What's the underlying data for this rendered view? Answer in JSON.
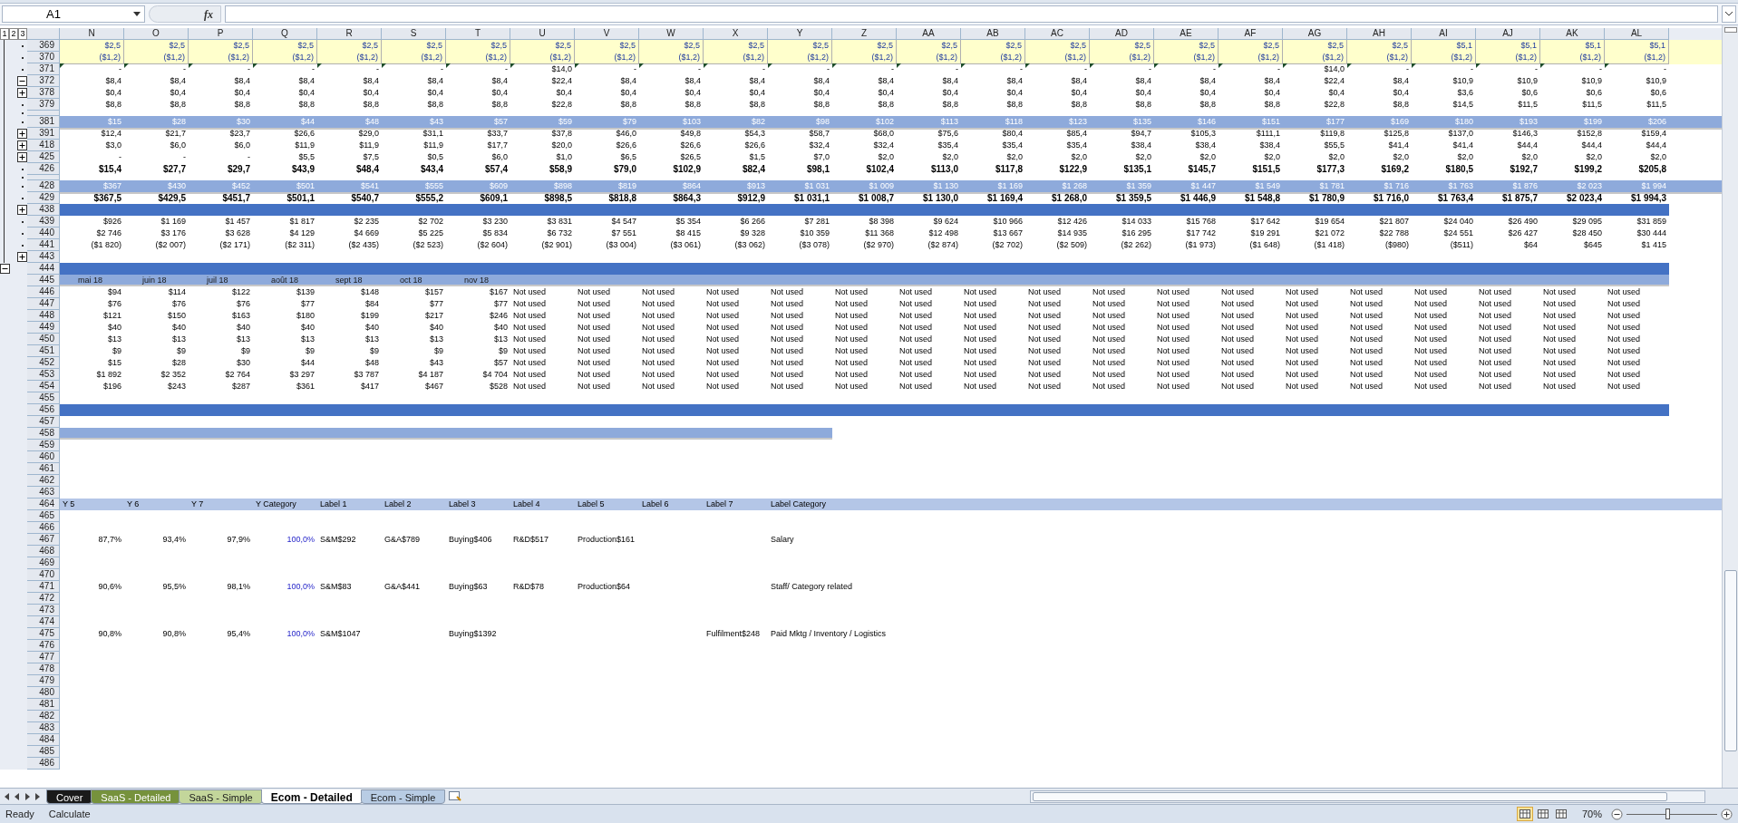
{
  "formula_bar": {
    "name_box": "A1",
    "fx": "fx"
  },
  "outline_levels": [
    "1",
    "2",
    "3"
  ],
  "columns": [
    "N",
    "O",
    "P",
    "Q",
    "R",
    "S",
    "T",
    "U",
    "V",
    "W",
    "X",
    "Y",
    "Z",
    "AA",
    "AB",
    "AC",
    "AD",
    "AE",
    "AF",
    "AG",
    "AH",
    "AI",
    "AJ",
    "AK",
    "AL"
  ],
  "rows": [
    {
      "n": "369",
      "kind": "input",
      "grouped": true,
      "cells": [
        "$2,5",
        "$2,5",
        "$2,5",
        "$2,5",
        "$2,5",
        "$2,5",
        "$2,5",
        "$2,5",
        "$2,5",
        "$2,5",
        "$2,5",
        "$2,5",
        "$2,5",
        "$2,5",
        "$2,5",
        "$2,5",
        "$2,5",
        "$2,5",
        "$2,5",
        "$2,5",
        "$2,5",
        "$5,1",
        "$5,1",
        "$5,1",
        "$5,1"
      ]
    },
    {
      "n": "370",
      "kind": "input",
      "grouped": true,
      "cells": [
        "($1,2)",
        "($1,2)",
        "($1,2)",
        "($1,2)",
        "($1,2)",
        "($1,2)",
        "($1,2)",
        "($1,2)",
        "($1,2)",
        "($1,2)",
        "($1,2)",
        "($1,2)",
        "($1,2)",
        "($1,2)",
        "($1,2)",
        "($1,2)",
        "($1,2)",
        "($1,2)",
        "($1,2)",
        "($1,2)",
        "($1,2)",
        "($1,2)",
        "($1,2)",
        "($1,2)",
        "($1,2)"
      ]
    },
    {
      "n": "371",
      "kind": "plain",
      "grouped": true,
      "flagged": true,
      "cells": [
        "-",
        "-",
        "-",
        "-",
        "-",
        "-",
        "-",
        "$14,0",
        "-",
        "-",
        "-",
        "-",
        "-",
        "-",
        "-",
        "-",
        "-",
        "-",
        "-",
        "$14,0",
        "-",
        "-",
        "-",
        "-",
        "-"
      ]
    },
    {
      "n": "372",
      "kind": "plain",
      "collapsed": false,
      "cells": [
        "$8,4",
        "$8,4",
        "$8,4",
        "$8,4",
        "$8,4",
        "$8,4",
        "$8,4",
        "$22,4",
        "$8,4",
        "$8,4",
        "$8,4",
        "$8,4",
        "$8,4",
        "$8,4",
        "$8,4",
        "$8,4",
        "$8,4",
        "$8,4",
        "$8,4",
        "$22,4",
        "$8,4",
        "$10,9",
        "$10,9",
        "$10,9",
        "$10,9"
      ]
    },
    {
      "n": "378",
      "kind": "plain",
      "collapsed": true,
      "cells": [
        "$0,4",
        "$0,4",
        "$0,4",
        "$0,4",
        "$0,4",
        "$0,4",
        "$0,4",
        "$0,4",
        "$0,4",
        "$0,4",
        "$0,4",
        "$0,4",
        "$0,4",
        "$0,4",
        "$0,4",
        "$0,4",
        "$0,4",
        "$0,4",
        "$0,4",
        "$0,4",
        "$0,4",
        "$3,6",
        "$0,6",
        "$0,6",
        "$0,6"
      ]
    },
    {
      "n": "379",
      "kind": "plain",
      "grouped": true,
      "cells": [
        "$8,8",
        "$8,8",
        "$8,8",
        "$8,8",
        "$8,8",
        "$8,8",
        "$8,8",
        "$22,8",
        "$8,8",
        "$8,8",
        "$8,8",
        "$8,8",
        "$8,8",
        "$8,8",
        "$8,8",
        "$8,8",
        "$8,8",
        "$8,8",
        "$8,8",
        "$22,8",
        "$8,8",
        "$14,5",
        "$11,5",
        "$11,5",
        "$11,5"
      ]
    },
    {
      "kind": "gap",
      "grouped": true
    },
    {
      "n": "381",
      "kind": "band",
      "grouped": true,
      "cells": [
        "$15",
        "$28",
        "$30",
        "$44",
        "$48",
        "$43",
        "$57",
        "$59",
        "$79",
        "$103",
        "$82",
        "$98",
        "$102",
        "$113",
        "$118",
        "$123",
        "$135",
        "$146",
        "$151",
        "$177",
        "$169",
        "$180",
        "$193",
        "$199",
        "$206"
      ]
    },
    {
      "n": "391",
      "kind": "plain",
      "collapsed": true,
      "cells": [
        "$12,4",
        "$21,7",
        "$23,7",
        "$26,6",
        "$29,0",
        "$31,1",
        "$33,7",
        "$37,8",
        "$46,0",
        "$49,8",
        "$54,3",
        "$58,7",
        "$68,0",
        "$75,6",
        "$80,4",
        "$85,4",
        "$94,7",
        "$105,3",
        "$111,1",
        "$119,8",
        "$125,8",
        "$137,0",
        "$146,3",
        "$152,8",
        "$159,4"
      ]
    },
    {
      "n": "418",
      "kind": "plain",
      "collapsed": true,
      "cells": [
        "$3,0",
        "$6,0",
        "$6,0",
        "$11,9",
        "$11,9",
        "$11,9",
        "$17,7",
        "$20,0",
        "$26,6",
        "$26,6",
        "$26,6",
        "$32,4",
        "$32,4",
        "$35,4",
        "$35,4",
        "$35,4",
        "$38,4",
        "$38,4",
        "$38,4",
        "$55,5",
        "$41,4",
        "$41,4",
        "$44,4",
        "$44,4",
        "$44,4"
      ]
    },
    {
      "n": "425",
      "kind": "plain",
      "collapsed": true,
      "cells": [
        "-",
        "-",
        "-",
        "$5,5",
        "$7,5",
        "$0,5",
        "$6,0",
        "$1,0",
        "$6,5",
        "$26,5",
        "$1,5",
        "$7,0",
        "$2,0",
        "$2,0",
        "$2,0",
        "$2,0",
        "$2,0",
        "$2,0",
        "$2,0",
        "$2,0",
        "$2,0",
        "$2,0",
        "$2,0",
        "$2,0",
        "$2,0"
      ]
    },
    {
      "n": "426",
      "kind": "bold",
      "grouped": true,
      "cells": [
        "$15,4",
        "$27,7",
        "$29,7",
        "$43,9",
        "$48,4",
        "$43,4",
        "$57,4",
        "$58,9",
        "$79,0",
        "$102,9",
        "$82,4",
        "$98,1",
        "$102,4",
        "$113,0",
        "$117,8",
        "$122,9",
        "$135,1",
        "$145,7",
        "$151,5",
        "$177,3",
        "$169,2",
        "$180,5",
        "$192,7",
        "$199,2",
        "$205,8"
      ]
    },
    {
      "kind": "gap",
      "grouped": true
    },
    {
      "n": "428",
      "kind": "band",
      "grouped": true,
      "cells": [
        "$367",
        "$430",
        "$452",
        "$501",
        "$541",
        "$555",
        "$609",
        "$898",
        "$819",
        "$864",
        "$913",
        "$1 031",
        "$1 009",
        "$1 130",
        "$1 169",
        "$1 268",
        "$1 359",
        "$1 447",
        "$1 549",
        "$1 781",
        "$1 716",
        "$1 763",
        "$1 876",
        "$2 023",
        "$1 994"
      ]
    },
    {
      "n": "429",
      "kind": "bold",
      "grouped": true,
      "cells": [
        "$367,5",
        "$429,5",
        "$451,7",
        "$501,1",
        "$540,7",
        "$555,2",
        "$609,1",
        "$898,5",
        "$818,8",
        "$864,3",
        "$912,9",
        "$1 031,1",
        "$1 008,7",
        "$1 130,0",
        "$1 169,4",
        "$1 268,0",
        "$1 359,5",
        "$1 446,9",
        "$1 548,8",
        "$1 780,9",
        "$1 716,0",
        "$1 763,4",
        "$1 875,7",
        "$2 023,4",
        "$1 994,3"
      ]
    },
    {
      "n": "438",
      "kind": "dark",
      "collapsed": true
    },
    {
      "n": "439",
      "kind": "plain",
      "grouped": true,
      "cells": [
        "$926",
        "$1 169",
        "$1 457",
        "$1 817",
        "$2 235",
        "$2 702",
        "$3 230",
        "$3 831",
        "$4 547",
        "$5 354",
        "$6 266",
        "$7 281",
        "$8 398",
        "$9 624",
        "$10 966",
        "$12 426",
        "$14 033",
        "$15 768",
        "$17 642",
        "$19 654",
        "$21 807",
        "$24 040",
        "$26 490",
        "$29 095",
        "$31 859"
      ]
    },
    {
      "n": "440",
      "kind": "plain",
      "grouped": true,
      "cells": [
        "$2 746",
        "$3 176",
        "$3 628",
        "$4 129",
        "$4 669",
        "$5 225",
        "$5 834",
        "$6 732",
        "$7 551",
        "$8 415",
        "$9 328",
        "$10 359",
        "$11 368",
        "$12 498",
        "$13 667",
        "$14 935",
        "$16 295",
        "$17 742",
        "$19 291",
        "$21 072",
        "$22 788",
        "$24 551",
        "$26 427",
        "$28 450",
        "$30 444"
      ]
    },
    {
      "n": "441",
      "kind": "plain",
      "grouped": true,
      "cells": [
        "($1 820)",
        "($2 007)",
        "($2 171)",
        "($2 311)",
        "($2 435)",
        "($2 523)",
        "($2 604)",
        "($2 901)",
        "($3 004)",
        "($3 061)",
        "($3 062)",
        "($3 078)",
        "($2 970)",
        "($2 874)",
        "($2 702)",
        "($2 509)",
        "($2 262)",
        "($1 973)",
        "($1 648)",
        "($1 418)",
        "($980)",
        "($511)",
        "$64",
        "$645",
        "$1 415"
      ]
    },
    {
      "n": "443",
      "kind": "empty",
      "collapsed": true
    },
    {
      "n": "444",
      "kind": "dark",
      "collapsed": false,
      "outer": true
    },
    {
      "n": "445",
      "kind": "header",
      "cells": [
        "mai 18",
        "juin 18",
        "juil 18",
        "août 18",
        "sept 18",
        "oct 18",
        "nov 18"
      ]
    },
    {
      "n": "446",
      "kind": "mixed",
      "values": [
        "$94",
        "$114",
        "$122",
        "$139",
        "$148",
        "$157",
        "$167"
      ],
      "labels": [
        "Not used",
        "Not used",
        "Not used",
        "Not used",
        "Not used",
        "Not used",
        "Not used",
        "Not used",
        "Not used",
        "Not used",
        "Not used",
        "Not used",
        "Not used",
        "Not used",
        "Not used",
        "Not used",
        "Not used",
        "Not used"
      ]
    },
    {
      "n": "447",
      "kind": "mixed",
      "values": [
        "$76",
        "$76",
        "$76",
        "$77",
        "$84",
        "$77",
        "$77"
      ],
      "labels": [
        "Not used",
        "Not used",
        "Not used",
        "Not used",
        "Not used",
        "Not used",
        "Not used",
        "Not used",
        "Not used",
        "Not used",
        "Not used",
        "Not used",
        "Not used",
        "Not used",
        "Not used",
        "Not used",
        "Not used",
        "Not used"
      ]
    },
    {
      "n": "448",
      "kind": "mixed",
      "values": [
        "$121",
        "$150",
        "$163",
        "$180",
        "$199",
        "$217",
        "$246"
      ],
      "labels": [
        "Not used",
        "Not used",
        "Not used",
        "Not used",
        "Not used",
        "Not used",
        "Not used",
        "Not used",
        "Not used",
        "Not used",
        "Not used",
        "Not used",
        "Not used",
        "Not used",
        "Not used",
        "Not used",
        "Not used",
        "Not used"
      ]
    },
    {
      "n": "449",
      "kind": "mixed",
      "values": [
        "$40",
        "$40",
        "$40",
        "$40",
        "$40",
        "$40",
        "$40"
      ],
      "labels": [
        "Not used",
        "Not used",
        "Not used",
        "Not used",
        "Not used",
        "Not used",
        "Not used",
        "Not used",
        "Not used",
        "Not used",
        "Not used",
        "Not used",
        "Not used",
        "Not used",
        "Not used",
        "Not used",
        "Not used",
        "Not used"
      ]
    },
    {
      "n": "450",
      "kind": "mixed",
      "values": [
        "$13",
        "$13",
        "$13",
        "$13",
        "$13",
        "$13",
        "$13"
      ],
      "labels": [
        "Not used",
        "Not used",
        "Not used",
        "Not used",
        "Not used",
        "Not used",
        "Not used",
        "Not used",
        "Not used",
        "Not used",
        "Not used",
        "Not used",
        "Not used",
        "Not used",
        "Not used",
        "Not used",
        "Not used",
        "Not used"
      ]
    },
    {
      "n": "451",
      "kind": "mixed",
      "values": [
        "$9",
        "$9",
        "$9",
        "$9",
        "$9",
        "$9",
        "$9"
      ],
      "labels": [
        "Not used",
        "Not used",
        "Not used",
        "Not used",
        "Not used",
        "Not used",
        "Not used",
        "Not used",
        "Not used",
        "Not used",
        "Not used",
        "Not used",
        "Not used",
        "Not used",
        "Not used",
        "Not used",
        "Not used",
        "Not used"
      ]
    },
    {
      "n": "452",
      "kind": "mixed",
      "values": [
        "$15",
        "$28",
        "$30",
        "$44",
        "$48",
        "$43",
        "$57"
      ],
      "labels": [
        "Not used",
        "Not used",
        "Not used",
        "Not used",
        "Not used",
        "Not used",
        "Not used",
        "Not used",
        "Not used",
        "Not used",
        "Not used",
        "Not used",
        "Not used",
        "Not used",
        "Not used",
        "Not used",
        "Not used",
        "Not used"
      ]
    },
    {
      "n": "453",
      "kind": "mixed",
      "values": [
        "$1 892",
        "$2 352",
        "$2 764",
        "$3 297",
        "$3 787",
        "$4 187",
        "$4 704"
      ],
      "labels": [
        "Not used",
        "Not used",
        "Not used",
        "Not used",
        "Not used",
        "Not used",
        "Not used",
        "Not used",
        "Not used",
        "Not used",
        "Not used",
        "Not used",
        "Not used",
        "Not used",
        "Not used",
        "Not used",
        "Not used",
        "Not used"
      ]
    },
    {
      "n": "454",
      "kind": "mixed",
      "values": [
        "$196",
        "$243",
        "$287",
        "$361",
        "$417",
        "$467",
        "$528"
      ],
      "labels": [
        "Not used",
        "Not used",
        "Not used",
        "Not used",
        "Not used",
        "Not used",
        "Not used",
        "Not used",
        "Not used",
        "Not used",
        "Not used",
        "Not used",
        "Not used",
        "Not used",
        "Not used",
        "Not used",
        "Not used",
        "Not used"
      ]
    },
    {
      "n": "455",
      "kind": "empty"
    },
    {
      "n": "456",
      "kind": "dark"
    },
    {
      "n": "457",
      "kind": "empty"
    },
    {
      "n": "458",
      "kind": "short-band"
    },
    {
      "n": "459",
      "kind": "empty"
    },
    {
      "n": "460",
      "kind": "empty"
    },
    {
      "n": "461",
      "kind": "empty"
    },
    {
      "n": "462",
      "kind": "empty"
    },
    {
      "n": "463",
      "kind": "empty"
    },
    {
      "n": "464",
      "kind": "label-header",
      "cells": [
        "Y 5",
        "Y 6",
        "Y 7",
        "Y Category",
        "Label 1",
        "Label 2",
        "Label 3",
        "Label 4",
        "Label 5",
        "Label 6",
        "Label 7",
        "Label Category"
      ]
    },
    {
      "n": "465",
      "kind": "empty"
    },
    {
      "n": "466",
      "kind": "empty"
    },
    {
      "n": "467",
      "kind": "ratios",
      "values": [
        "87,7%",
        "93,4%",
        "97,9%"
      ],
      "category": "100,0%",
      "labels": [
        {
          "kind": "label",
          "text": "S&M$292"
        },
        {
          "kind": "label",
          "text": "G&A$789"
        },
        {
          "kind": "label",
          "text": "Buying$406"
        },
        {
          "kind": "label",
          "text": "R&D$517"
        },
        {
          "kind": "label",
          "text": "Production$161"
        },
        {
          "kind": "blank"
        },
        {
          "kind": "blank"
        },
        {
          "kind": "label",
          "text": "Salary"
        }
      ]
    },
    {
      "n": "468",
      "kind": "empty"
    },
    {
      "n": "469",
      "kind": "empty"
    },
    {
      "n": "470",
      "kind": "empty"
    },
    {
      "n": "471",
      "kind": "ratios",
      "values": [
        "90,6%",
        "95,5%",
        "98,1%"
      ],
      "category": "100,0%",
      "labels": [
        {
          "kind": "label",
          "text": "S&M$83"
        },
        {
          "kind": "label",
          "text": "G&A$441"
        },
        {
          "kind": "label",
          "text": "Buying$63"
        },
        {
          "kind": "label",
          "text": "R&D$78"
        },
        {
          "kind": "label",
          "text": "Production$64"
        },
        {
          "kind": "blank"
        },
        {
          "kind": "blank"
        },
        {
          "kind": "label",
          "text": "Staff/ Category related"
        }
      ]
    },
    {
      "n": "472",
      "kind": "empty"
    },
    {
      "n": "473",
      "kind": "empty"
    },
    {
      "n": "474",
      "kind": "empty"
    },
    {
      "n": "475",
      "kind": "ratios",
      "values": [
        "90,8%",
        "90,8%",
        "95,4%"
      ],
      "category": "100,0%",
      "labels": [
        {
          "kind": "label",
          "text": "S&M$1047"
        },
        {
          "kind": "blank"
        },
        {
          "kind": "label",
          "text": "Buying$1392"
        },
        {
          "kind": "blank"
        },
        {
          "kind": "blank"
        },
        {
          "kind": "blank"
        },
        {
          "kind": "label",
          "text": "Fulfilment$248"
        },
        {
          "kind": "label",
          "text": "Paid Mktg / Inventory / Logistics"
        }
      ]
    },
    {
      "n": "476",
      "kind": "empty"
    },
    {
      "n": "477",
      "kind": "empty"
    },
    {
      "n": "478",
      "kind": "empty"
    },
    {
      "n": "479",
      "kind": "empty"
    },
    {
      "n": "480",
      "kind": "empty"
    },
    {
      "n": "481",
      "kind": "empty"
    },
    {
      "n": "482",
      "kind": "empty"
    },
    {
      "n": "483",
      "kind": "empty"
    },
    {
      "n": "484",
      "kind": "empty"
    },
    {
      "n": "485",
      "kind": "empty"
    },
    {
      "n": "486",
      "kind": "empty"
    }
  ],
  "sheet_tabs": [
    {
      "label": "Cover",
      "selected": false,
      "color": "#1a1a1a"
    },
    {
      "label": "SaaS - Detailed",
      "selected": false,
      "color": "#76923c"
    },
    {
      "label": "SaaS - Simple",
      "selected": false,
      "color": "#c3d69b"
    },
    {
      "label": "Ecom - Detailed",
      "selected": true,
      "color": "#ffffff"
    },
    {
      "label": "Ecom - Simple",
      "selected": false,
      "color": "#b8cce4"
    }
  ],
  "status_bar": {
    "mode": "Ready",
    "action": "Calculate",
    "views": [
      {
        "selected": true
      },
      {
        "selected": false
      },
      {
        "selected": false
      }
    ],
    "zoom": "70%",
    "zoom_slider": {
      "level": 0.45
    }
  }
}
